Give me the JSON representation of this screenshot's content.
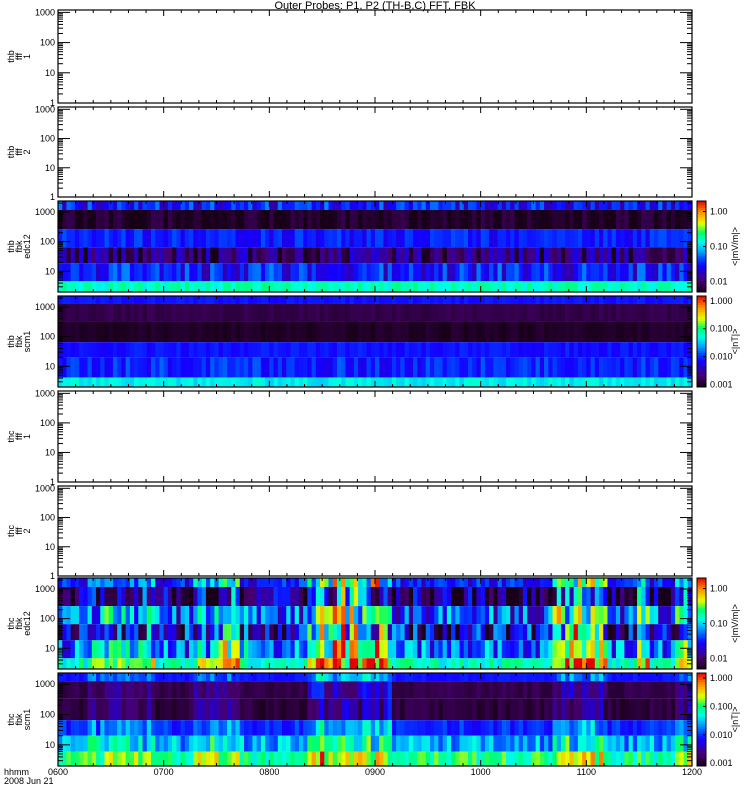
{
  "chart_data": {
    "type": "heatmap",
    "title": "Outer Probes: P1, P2 (TH-B,C) FFT, FBK",
    "xlabel": [
      "hhmm",
      "2008 Jun 21"
    ],
    "xlim": [
      6.0,
      12.0
    ],
    "xticks": [
      6,
      7,
      8,
      9,
      10,
      11,
      12
    ],
    "xtick_labels": [
      "0600",
      "0700",
      "0800",
      "0900",
      "1000",
      "1100",
      "1200"
    ],
    "panels": [
      {
        "label": [
          "thb",
          "fff",
          "1"
        ],
        "kind": "empty",
        "ylim": [
          1,
          1200
        ],
        "yticks": [
          1,
          10,
          100,
          1000
        ],
        "ytick_labels": [
          "1",
          "10",
          "100",
          "1000"
        ]
      },
      {
        "label": [
          "thb",
          "fff",
          "2"
        ],
        "kind": "empty",
        "ylim": [
          1,
          1200
        ],
        "yticks": [
          1,
          10,
          100,
          1000
        ],
        "ytick_labels": [
          "1",
          "10",
          "100",
          "1000"
        ]
      },
      {
        "label": [
          "thb",
          "fbk",
          "edc12"
        ],
        "kind": "spec",
        "ylim": [
          2,
          2350
        ],
        "yticks": [
          10,
          100,
          1000
        ],
        "ytick_labels": [
          "10",
          "100",
          "1000"
        ],
        "colorbar": {
          "label": "<|mV/m|>",
          "range": [
            0.005,
            2.0
          ],
          "ticks": [
            0.01,
            0.1,
            1.0
          ],
          "tick_labels": [
            "0.01",
            "0.10",
            "1.00"
          ]
        },
        "bands": [
          {
            "f": [
              1170,
              2350
            ],
            "level": 0.3,
            "var": 0.12
          },
          {
            "f": [
              265,
              1170
            ],
            "level": 0.02,
            "var": 0.06
          },
          {
            "f": [
              65,
              265
            ],
            "level": 0.31,
            "var": 0.06
          },
          {
            "f": [
              18.6,
              65
            ],
            "level": 0.12,
            "var": 0.14
          },
          {
            "f": [
              4.6,
              18.6
            ],
            "level": 0.3,
            "var": 0.12
          },
          {
            "f": [
              2,
              4.6
            ],
            "level": 0.58,
            "var": 0.05
          }
        ],
        "activity": []
      },
      {
        "label": [
          "thb",
          "fbk",
          "scm1"
        ],
        "kind": "spec",
        "ylim": [
          2,
          2350
        ],
        "yticks": [
          10,
          100,
          1000
        ],
        "ytick_labels": [
          "10",
          "100",
          "1000"
        ],
        "colorbar": {
          "label": "<|nT|>",
          "range": [
            0.0008,
            1.5
          ],
          "ticks": [
            0.001,
            0.01,
            0.1,
            1.0
          ],
          "tick_labels": [
            "0.001",
            "0.010",
            "0.100",
            "1.000"
          ]
        },
        "bands": [
          {
            "f": [
              1264,
              2350
            ],
            "level": 0.3,
            "var": 0.02
          },
          {
            "f": [
              335,
              1264
            ],
            "level": 0.07,
            "var": 0.02
          },
          {
            "f": [
              65,
              335
            ],
            "level": 0.02,
            "var": 0.02
          },
          {
            "f": [
              20,
              65
            ],
            "level": 0.3,
            "var": 0.03
          },
          {
            "f": [
              4.2,
              20
            ],
            "level": 0.32,
            "var": 0.07
          },
          {
            "f": [
              2,
              4.2
            ],
            "level": 0.53,
            "var": 0.04
          }
        ],
        "activity": []
      },
      {
        "label": [
          "thc",
          "fff",
          "1"
        ],
        "kind": "empty",
        "ylim": [
          1,
          1200
        ],
        "yticks": [
          1,
          10,
          100,
          1000
        ],
        "ytick_labels": [
          "1",
          "10",
          "100",
          "1000"
        ]
      },
      {
        "label": [
          "thc",
          "fff",
          "2"
        ],
        "kind": "empty",
        "ylim": [
          1,
          1200
        ],
        "yticks": [
          1,
          10,
          100,
          1000
        ],
        "ytick_labels": [
          "1",
          "10",
          "100",
          "1000"
        ]
      },
      {
        "label": [
          "thc",
          "fbk",
          "edc12"
        ],
        "kind": "spec",
        "ylim": [
          2,
          2350
        ],
        "yticks": [
          10,
          100,
          1000
        ],
        "ytick_labels": [
          "10",
          "100",
          "1000"
        ],
        "colorbar": {
          "label": "<|mV/m|>",
          "range": [
            0.005,
            2.0
          ],
          "ticks": [
            0.01,
            0.1,
            1.0
          ],
          "tick_labels": [
            "0.01",
            "0.10",
            "1.00"
          ]
        },
        "bands": [
          {
            "f": [
              1170,
              2350
            ],
            "level": 0.3,
            "var": 0.1
          },
          {
            "f": [
              265,
              1170
            ],
            "level": 0.1,
            "var": 0.25
          },
          {
            "f": [
              65,
              265
            ],
            "level": 0.35,
            "var": 0.2
          },
          {
            "f": [
              18.6,
              65
            ],
            "level": 0.22,
            "var": 0.25
          },
          {
            "f": [
              4.6,
              18.6
            ],
            "level": 0.38,
            "var": 0.18
          },
          {
            "f": [
              2,
              4.6
            ],
            "level": 0.58,
            "var": 0.08
          }
        ],
        "activity": [
          [
            6.3,
            6.9,
            0.15
          ],
          [
            7.3,
            7.7,
            0.25
          ],
          [
            7.75,
            7.8,
            0.45
          ],
          [
            8.35,
            9.15,
            0.4
          ],
          [
            10.7,
            11.2,
            0.4
          ],
          [
            11.5,
            11.6,
            0.25
          ],
          [
            11.85,
            12.0,
            0.3
          ]
        ]
      },
      {
        "label": [
          "thc",
          "fbk",
          "scm1"
        ],
        "kind": "spec",
        "ylim": [
          2,
          2350
        ],
        "yticks": [
          10,
          100,
          1000
        ],
        "ytick_labels": [
          "10",
          "100",
          "1000"
        ],
        "colorbar": {
          "label": "<|nT|>",
          "range": [
            0.0008,
            1.5
          ],
          "ticks": [
            0.001,
            0.01,
            0.1,
            1.0
          ],
          "tick_labels": [
            "0.001",
            "0.010",
            "0.100",
            "1.000"
          ]
        },
        "bands": [
          {
            "f": [
              1264,
              2350
            ],
            "level": 0.3,
            "var": 0.02
          },
          {
            "f": [
              335,
              1264
            ],
            "level": 0.07,
            "var": 0.03
          },
          {
            "f": [
              65,
              335
            ],
            "level": 0.05,
            "var": 0.04
          },
          {
            "f": [
              20,
              65
            ],
            "level": 0.32,
            "var": 0.06
          },
          {
            "f": [
              6,
              20
            ],
            "level": 0.45,
            "var": 0.12
          },
          {
            "f": [
              2,
              6
            ],
            "level": 0.62,
            "var": 0.1
          }
        ],
        "activity": [
          [
            6.3,
            6.9,
            0.1
          ],
          [
            7.3,
            7.7,
            0.12
          ],
          [
            8.35,
            9.15,
            0.2
          ],
          [
            10.7,
            11.2,
            0.15
          ],
          [
            11.85,
            12.0,
            0.1
          ]
        ]
      }
    ]
  }
}
